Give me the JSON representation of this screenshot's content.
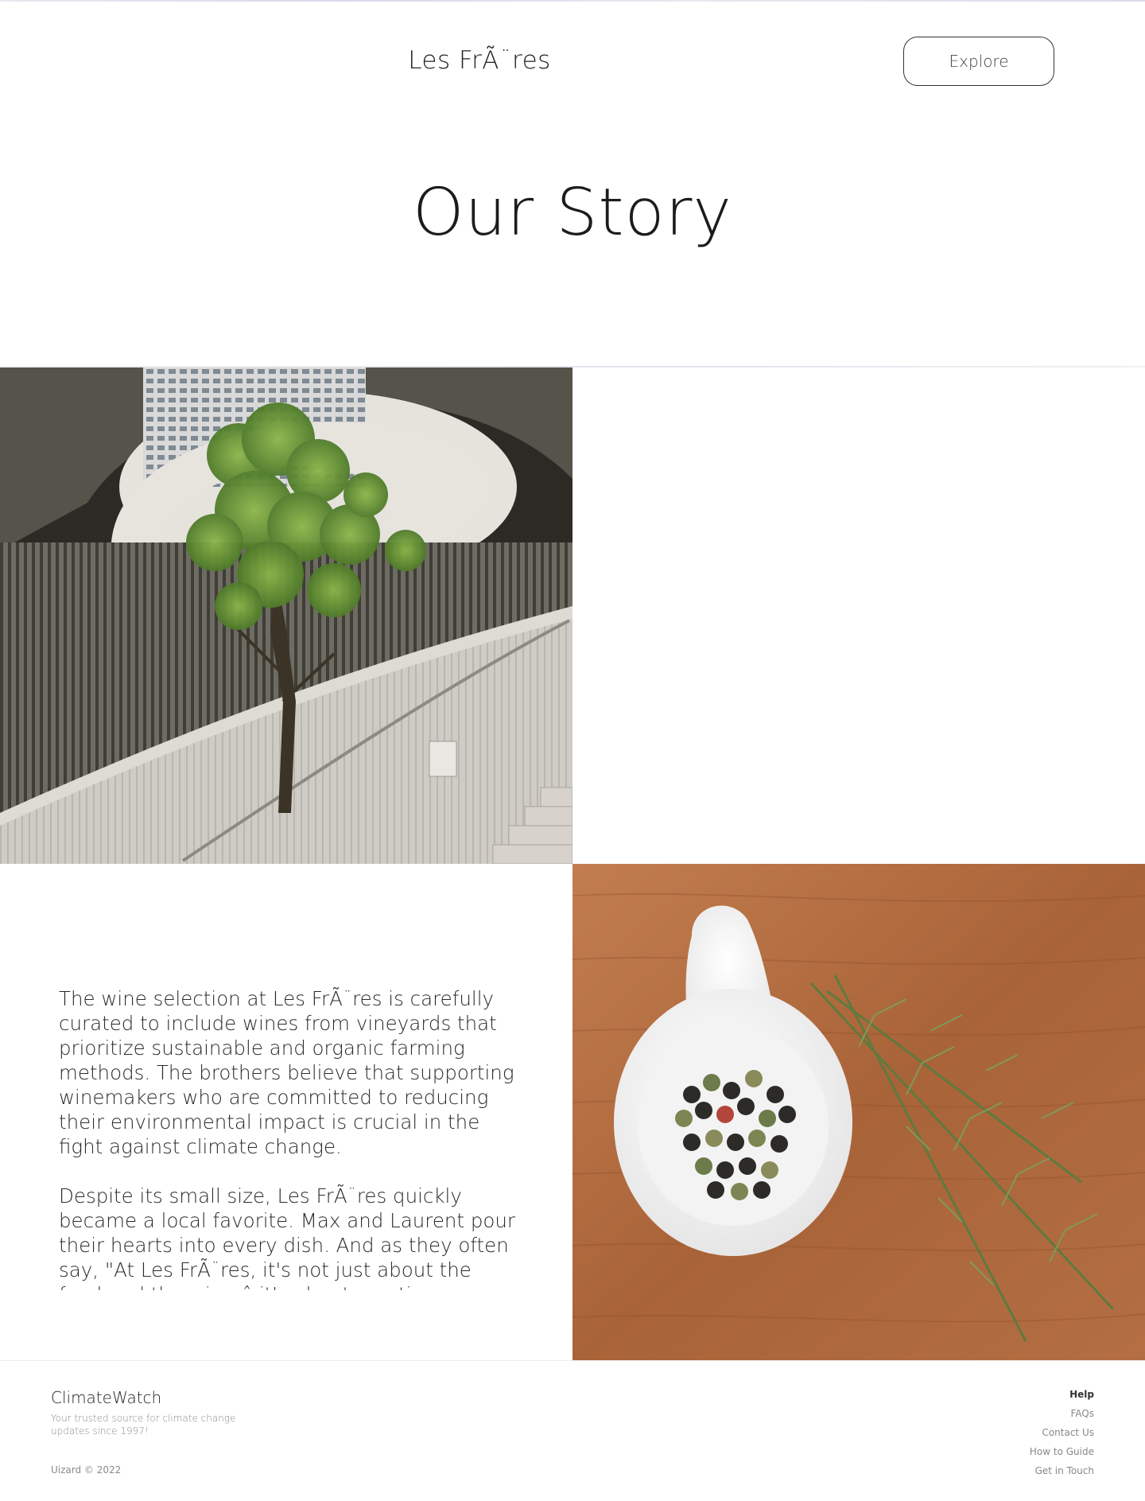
{
  "header": {
    "brand": "Les FrÃ¨res",
    "explore_label": "Explore"
  },
  "hero": {
    "title": "Our Story"
  },
  "story": {
    "paragraphs": [
      "The wine selection at Les FrÃ¨res is carefully curated to include wines from vineyards that prioritize sustainable and organic farming methods. The brothers believe that supporting winemakers who are committed to reducing their environmental impact is crucial in the fight against climate change.",
      "Despite its small size, Les FrÃ¨res quickly became a local favorite. Max and Laurent pour their hearts into every dish. And as they often say, \"At Les FrÃ¨res, it's not just about the food and the wine â it's about creating a"
    ]
  },
  "images": {
    "architecture": "architecture-staircase-tree",
    "spices": "peppercorns-rosemary"
  },
  "footer": {
    "brand": "ClimateWatch",
    "tagline": "Your trusted source for climate change updates since 1997!",
    "copyright": "Uizard © 2022",
    "links_heading": "Help",
    "links": [
      "FAQs",
      "Contact Us",
      "How to Guide",
      "Get in Touch"
    ]
  }
}
